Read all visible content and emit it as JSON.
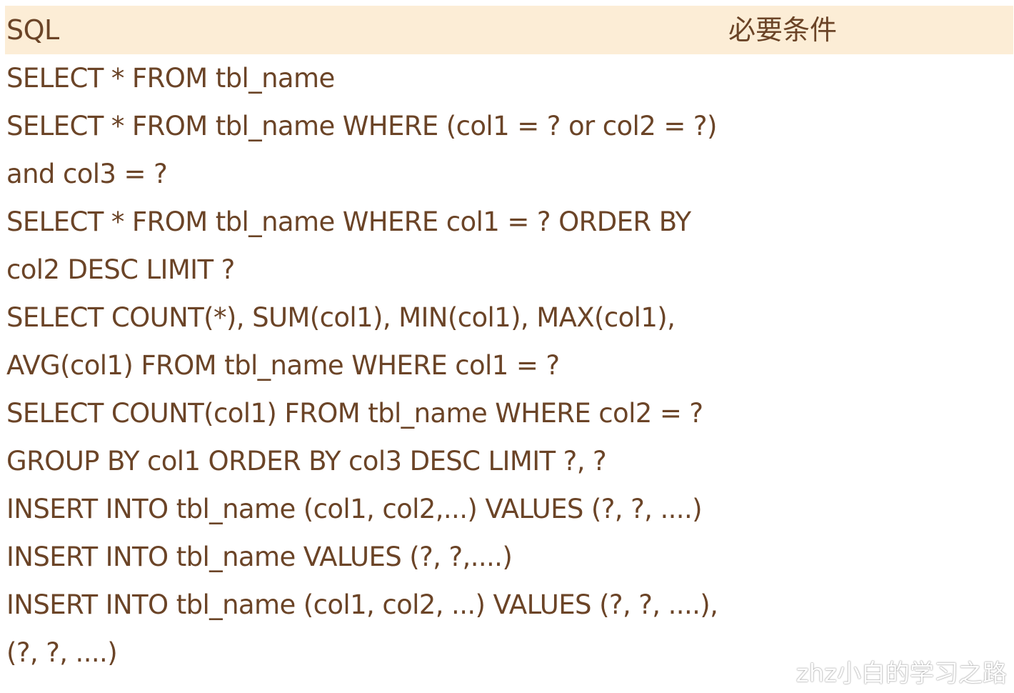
{
  "header": {
    "sql": "SQL",
    "condition": "必要条件"
  },
  "rows": [
    {
      "lines": [
        "SELECT * FROM tbl_name"
      ]
    },
    {
      "lines": [
        "SELECT * FROM tbl_name WHERE (col1 = ? or col2 = ?)",
        "and col3 = ?"
      ]
    },
    {
      "lines": [
        "SELECT * FROM tbl_name WHERE col1 = ? ORDER BY",
        "col2 DESC LIMIT ?"
      ]
    },
    {
      "lines": [
        "SELECT COUNT(*), SUM(col1), MIN(col1), MAX(col1),",
        "AVG(col1) FROM tbl_name WHERE col1 = ?"
      ]
    },
    {
      "lines": [
        "SELECT COUNT(col1) FROM tbl_name WHERE col2 = ?",
        "GROUP BY col1 ORDER BY col3 DESC LIMIT ?, ?"
      ]
    },
    {
      "lines": [
        "INSERT INTO tbl_name (col1, col2,...) VALUES (?, ?, ....)"
      ]
    },
    {
      "lines": [
        "INSERT INTO tbl_name VALUES (?, ?,....)"
      ]
    },
    {
      "lines": [
        "INSERT INTO tbl_name (col1, col2, ...) VALUES (?, ?, ....),",
        "(?, ?, ....)"
      ]
    }
  ],
  "watermark": "zhz小白的学习之路"
}
